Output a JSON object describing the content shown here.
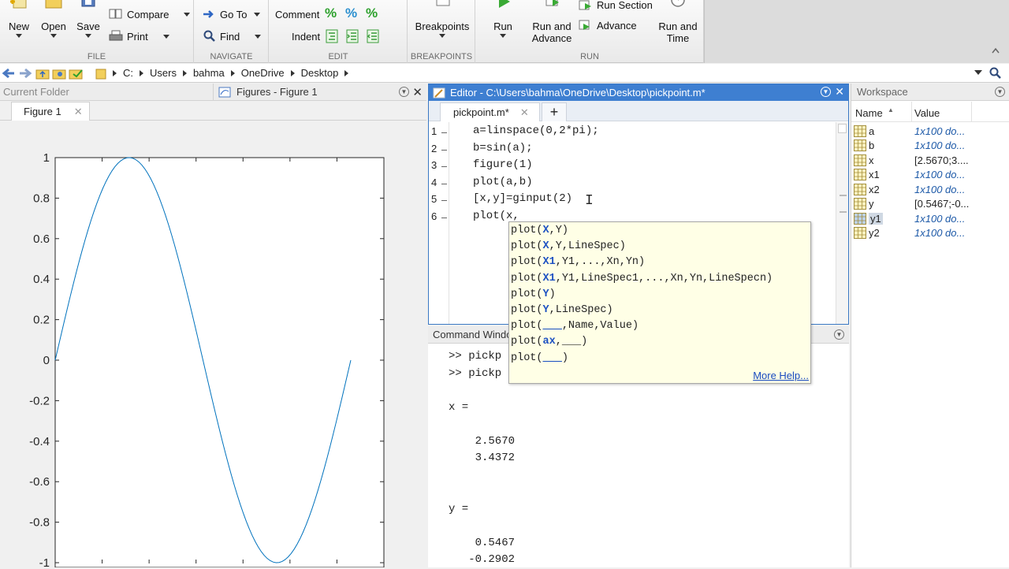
{
  "toolstrip": {
    "file": {
      "label": "FILE",
      "new": "New",
      "open": "Open",
      "save": "Save",
      "compare": "Compare",
      "print": "Print"
    },
    "navigate": {
      "label": "NAVIGATE",
      "goto": "Go To",
      "find": "Find"
    },
    "edit": {
      "label": "EDIT",
      "comment": "Comment",
      "indent": "Indent"
    },
    "breakpoints": {
      "label": "BREAKPOINTS",
      "breakpoints": "Breakpoints"
    },
    "run": {
      "label": "RUN",
      "run": "Run",
      "run_advance_1": "Run and",
      "run_advance_2": "Advance",
      "run_section": "Run Section",
      "advance": "Advance",
      "run_time_1": "Run and",
      "run_time_2": "Time"
    }
  },
  "address": {
    "crumbs": [
      "C:",
      "Users",
      "bahma",
      "OneDrive",
      "Desktop"
    ]
  },
  "panels": {
    "current_folder": "Current Folder",
    "figures_title": "Figures - Figure 1",
    "figure_tab": "Figure 1",
    "editor_title": "Editor - C:\\Users\\bahma\\OneDrive\\Desktop\\pickpoint.m*",
    "editor_tab": "pickpoint.m*",
    "command_window": "Command Window",
    "workspace": "Workspace"
  },
  "editor": {
    "lines": [
      {
        "num": "1",
        "code": "a=linspace(0,2*pi);"
      },
      {
        "num": "2",
        "code": "b=sin(a);"
      },
      {
        "num": "3",
        "code": "figure(1)"
      },
      {
        "num": "4",
        "code": "plot(a,b)"
      },
      {
        "num": "5",
        "code": "[x,y]=ginput(2)"
      },
      {
        "num": "6",
        "code": "plot(x,"
      }
    ]
  },
  "autocomplete": {
    "items": [
      {
        "pre": "plot(",
        "bold": "X",
        "post": ",Y)"
      },
      {
        "pre": "plot(",
        "bold": "X",
        "post": ",Y,LineSpec)"
      },
      {
        "pre": "plot(",
        "bold": "X1",
        "post": ",Y1,...,Xn,Yn)"
      },
      {
        "pre": "plot(",
        "bold": "X1",
        "post": ",Y1,LineSpec1,...,Xn,Yn,LineSpecn)"
      },
      {
        "pre": "plot(",
        "bold": "Y",
        "post": ")"
      },
      {
        "pre": "plot(",
        "bold": "Y",
        "post": ",LineSpec)"
      },
      {
        "pre": "plot(",
        "bold": "___",
        "post": ",Name,Value)"
      },
      {
        "pre": "plot(",
        "bold": "ax",
        "post": ",___)"
      },
      {
        "pre": "plot(",
        "bold": "___",
        "post": ")"
      }
    ],
    "more_help": "More Help..."
  },
  "command": {
    "text": ">> pickp\n>> pickp\n\nx =\n\n    2.5670\n    3.4372\n\n\ny =\n\n    0.5467\n   -0.2902"
  },
  "workspace": {
    "col_name": "Name",
    "col_value": "Value",
    "rows": [
      {
        "name": "a",
        "value": "1x100 do...",
        "italic": true
      },
      {
        "name": "b",
        "value": "1x100 do...",
        "italic": true
      },
      {
        "name": "x",
        "value": "[2.5670;3....",
        "italic": false
      },
      {
        "name": "x1",
        "value": "1x100 do...",
        "italic": true
      },
      {
        "name": "x2",
        "value": "1x100 do...",
        "italic": true
      },
      {
        "name": "y",
        "value": "[0.5467;-0...",
        "italic": false
      },
      {
        "name": "y1",
        "value": "1x100 do...",
        "italic": true
      },
      {
        "name": "y2",
        "value": "1x100 do...",
        "italic": true
      }
    ]
  },
  "chart_data": {
    "type": "line",
    "function": "sin",
    "x_range": [
      0,
      6.2832
    ],
    "ylim": [
      -1,
      1
    ],
    "yticks": [
      "1",
      "0.8",
      "0.6",
      "0.4",
      "0.2",
      "0",
      "-0.2",
      "-0.4",
      "-0.6",
      "-0.8",
      "-1"
    ],
    "line_color": "#0072bd"
  }
}
